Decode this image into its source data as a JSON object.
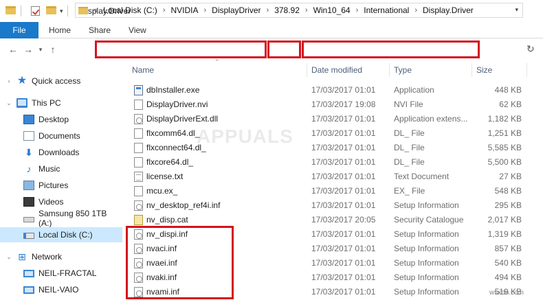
{
  "window": {
    "title": "Display.Driver"
  },
  "ribbon": {
    "tabs": [
      "File",
      "Home",
      "Share",
      "View"
    ]
  },
  "address": {
    "overflow": "«",
    "crumbs": [
      "Local Disk (C:)",
      "NVIDIA",
      "DisplayDriver",
      "378.92",
      "Win10_64",
      "International",
      "Display.Driver"
    ]
  },
  "sidebar": {
    "items": [
      {
        "label": "Quick access",
        "icon": "star-icon"
      },
      {
        "label": "This PC",
        "icon": "computer-icon"
      },
      {
        "label": "Desktop",
        "icon": "desktop-icon"
      },
      {
        "label": "Documents",
        "icon": "documents-icon"
      },
      {
        "label": "Downloads",
        "icon": "download-icon"
      },
      {
        "label": "Music",
        "icon": "music-icon"
      },
      {
        "label": "Pictures",
        "icon": "pictures-icon"
      },
      {
        "label": "Videos",
        "icon": "videos-icon"
      },
      {
        "label": "Samsung 850 1TB (A:)",
        "icon": "drive-icon"
      },
      {
        "label": "Local Disk (C:)",
        "icon": "local-disk-icon"
      },
      {
        "label": "Network",
        "icon": "network-icon"
      },
      {
        "label": "NEIL-FRACTAL",
        "icon": "computer-icon"
      },
      {
        "label": "NEIL-VAIO",
        "icon": "computer-icon"
      }
    ]
  },
  "columns": {
    "name": "Name",
    "date": "Date modified",
    "type": "Type",
    "size": "Size"
  },
  "files": [
    {
      "name": "dbInstaller.exe",
      "date": "17/03/2017 01:01",
      "type": "Application",
      "size": "448 KB"
    },
    {
      "name": "DisplayDriver.nvi",
      "date": "17/03/2017 19:08",
      "type": "NVI File",
      "size": "62 KB"
    },
    {
      "name": "DisplayDriverExt.dll",
      "date": "17/03/2017 01:01",
      "type": "Application extens...",
      "size": "1,182 KB"
    },
    {
      "name": "flxcomm64.dl_",
      "date": "17/03/2017 01:01",
      "type": "DL_ File",
      "size": "1,251 KB"
    },
    {
      "name": "flxconnect64.dl_",
      "date": "17/03/2017 01:01",
      "type": "DL_ File",
      "size": "5,585 KB"
    },
    {
      "name": "flxcore64.dl_",
      "date": "17/03/2017 01:01",
      "type": "DL_ File",
      "size": "5,500 KB"
    },
    {
      "name": "license.txt",
      "date": "17/03/2017 01:01",
      "type": "Text Document",
      "size": "27 KB"
    },
    {
      "name": "mcu.ex_",
      "date": "17/03/2017 01:01",
      "type": "EX_ File",
      "size": "548 KB"
    },
    {
      "name": "nv_desktop_ref4i.inf",
      "date": "17/03/2017 01:01",
      "type": "Setup Information",
      "size": "295 KB"
    },
    {
      "name": "nv_disp.cat",
      "date": "17/03/2017 20:05",
      "type": "Security Catalogue",
      "size": "2,017 KB"
    },
    {
      "name": "nv_dispi.inf",
      "date": "17/03/2017 01:01",
      "type": "Setup Information",
      "size": "1,319 KB"
    },
    {
      "name": "nvaci.inf",
      "date": "17/03/2017 01:01",
      "type": "Setup Information",
      "size": "857 KB"
    },
    {
      "name": "nvaei.inf",
      "date": "17/03/2017 01:01",
      "type": "Setup Information",
      "size": "540 KB"
    },
    {
      "name": "nvaki.inf",
      "date": "17/03/2017 01:01",
      "type": "Setup Information",
      "size": "494 KB"
    },
    {
      "name": "nvami.inf",
      "date": "17/03/2017 01:01",
      "type": "Setup Information",
      "size": "519 KB"
    }
  ],
  "watermark": {
    "logo": "APPUALS",
    "site": "wsxdn.com"
  },
  "colors": {
    "file_tab": "#1979ca",
    "highlight": "#d4121d",
    "selected": "#cce8ff"
  }
}
